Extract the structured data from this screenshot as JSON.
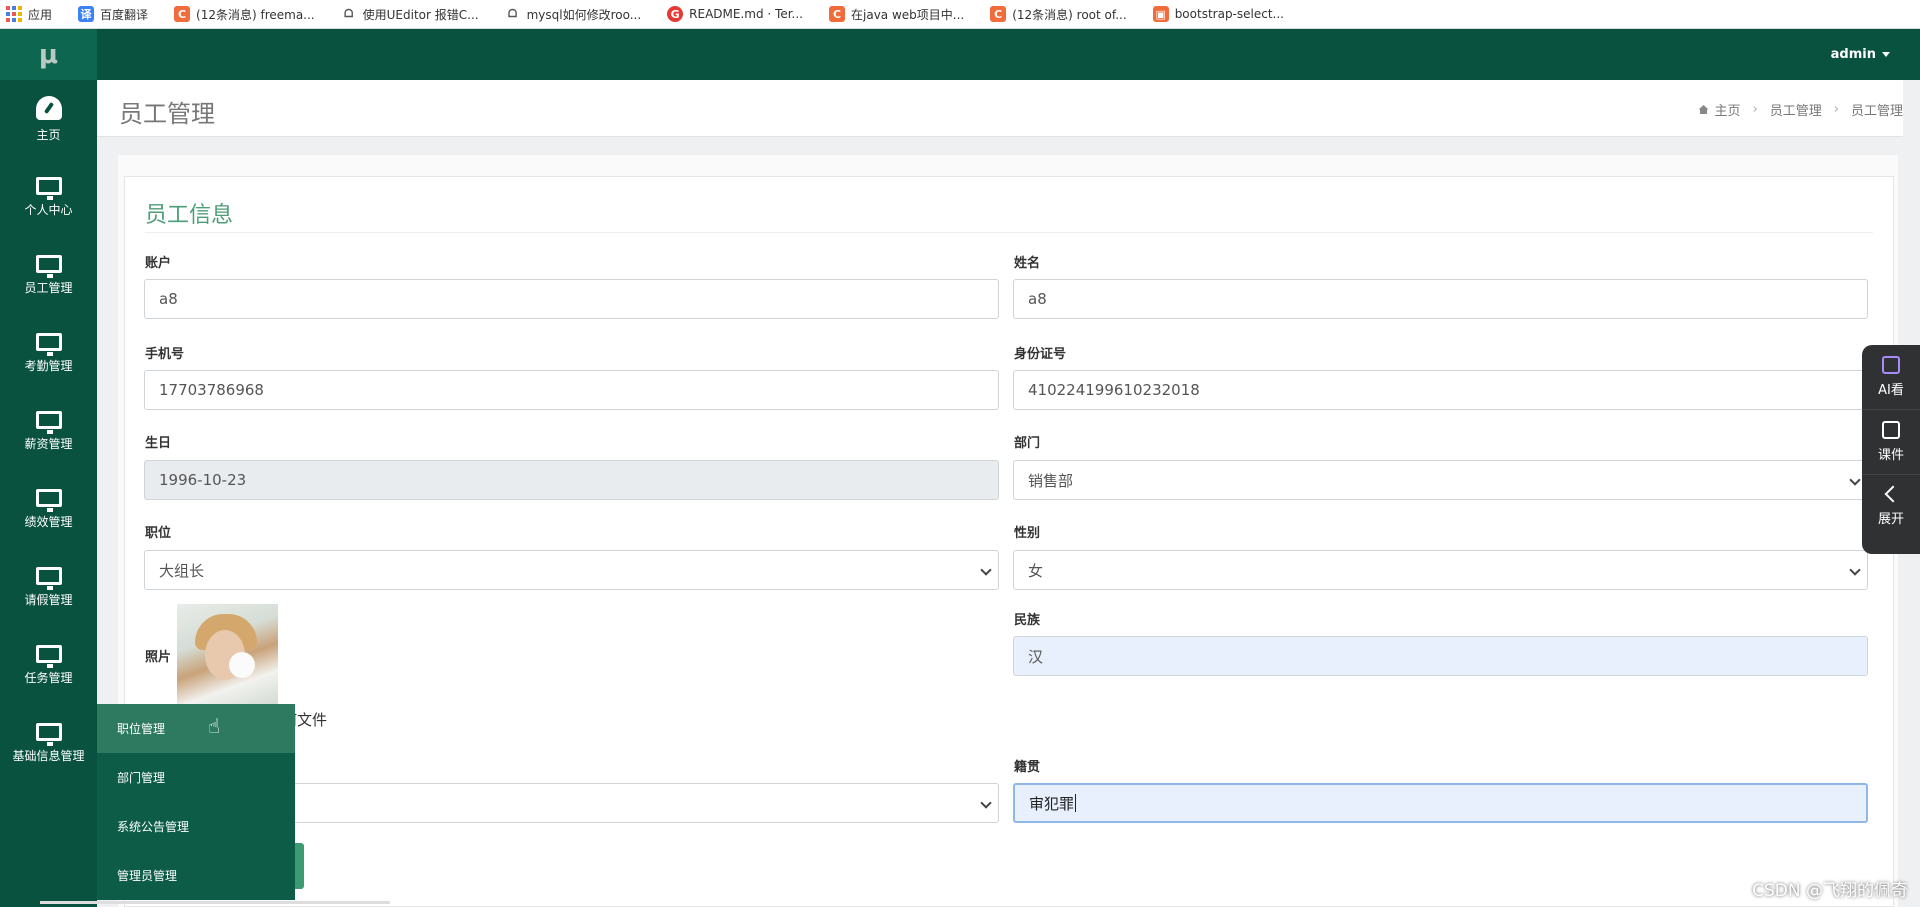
{
  "bookmarks": [
    {
      "label": "应用",
      "color": "#e55"
    },
    {
      "label": "百度翻译",
      "color": "#3b82f6"
    },
    {
      "label": "(12条消息) freema...",
      "color": "#f26b3a"
    },
    {
      "label": "使用UEditor 报错C...",
      "color": "#555555"
    },
    {
      "label": "mysql如何修改roo...",
      "color": "#555555"
    },
    {
      "label": "README.md · Ter...",
      "color": "#e53935"
    },
    {
      "label": "在java web项目中...",
      "color": "#f26b3a"
    },
    {
      "label": "(12条消息) root of...",
      "color": "#f26b3a"
    },
    {
      "label": "bootstrap-select...",
      "color": "#f26b3a"
    }
  ],
  "header": {
    "logo": "μ",
    "user": "admin"
  },
  "sidebar": {
    "items": [
      {
        "label": "主页",
        "icon": "dashboard-icon"
      },
      {
        "label": "个人中心",
        "icon": "monitor-icon"
      },
      {
        "label": "员工管理",
        "icon": "monitor-icon"
      },
      {
        "label": "考勤管理",
        "icon": "monitor-icon"
      },
      {
        "label": "薪资管理",
        "icon": "monitor-icon"
      },
      {
        "label": "绩效管理",
        "icon": "monitor-icon"
      },
      {
        "label": "请假管理",
        "icon": "monitor-icon"
      },
      {
        "label": "任务管理",
        "icon": "monitor-icon"
      },
      {
        "label": "基础信息管理",
        "icon": "monitor-icon"
      }
    ]
  },
  "submenu": {
    "items": [
      "职位管理",
      "部门管理",
      "系统公告管理",
      "管理员管理"
    ],
    "active": "职位管理"
  },
  "page": {
    "title": "员工管理",
    "breadcrumb": [
      "主页",
      "员工管理",
      "员工管理"
    ]
  },
  "form": {
    "section_title": "员工信息",
    "account_label": "账户",
    "account_value": "a8",
    "name_label": "姓名",
    "name_value": "a8",
    "phone_label": "手机号",
    "phone_value": "17703786968",
    "idcard_label": "身份证号",
    "idcard_value": "410224199610232018",
    "birthday_label": "生日",
    "birthday_value": "1996-10-23",
    "dept_label": "部门",
    "dept_value": "销售部",
    "position_label": "职位",
    "position_value": "大组长",
    "gender_label": "性别",
    "gender_value": "女",
    "photo_label": "照片",
    "file_text": "何文件",
    "ethnic_label": "民族",
    "ethnic_value": "汉",
    "native_label": "籍贯",
    "native_value": "审犯罪"
  },
  "float_panel": {
    "items": [
      "AI看",
      "课件",
      "展开"
    ]
  },
  "overlay": {
    "watermark": "CSDN @飞翔的佩奇"
  }
}
